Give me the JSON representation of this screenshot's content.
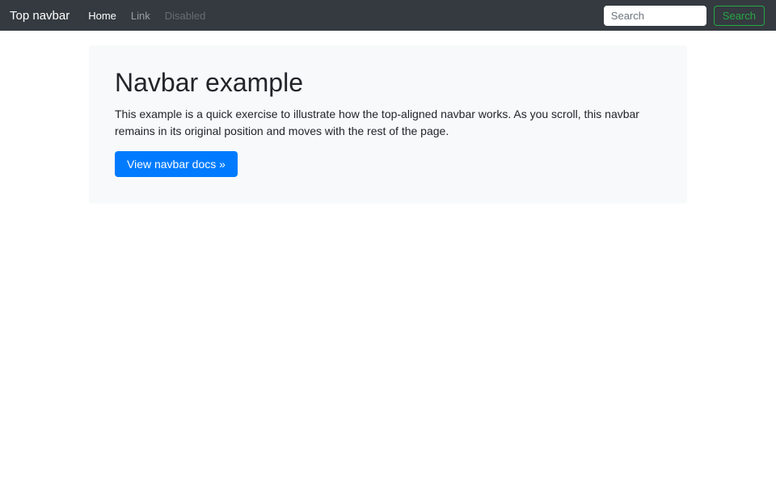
{
  "navbar": {
    "brand": "Top navbar",
    "links": [
      {
        "label": "Home",
        "state": "active"
      },
      {
        "label": "Link",
        "state": "normal"
      },
      {
        "label": "Disabled",
        "state": "disabled"
      }
    ],
    "search": {
      "placeholder": "Search",
      "button_label": "Search"
    }
  },
  "jumbotron": {
    "title": "Navbar example",
    "body": "This example is a quick exercise to illustrate how the top-aligned navbar works. As you scroll, this navbar remains in its original position and moves with the rest of the page.",
    "cta_label": "View navbar docs »"
  },
  "colors": {
    "navbar_bg": "#343a40",
    "primary": "#007bff",
    "success": "#28a745",
    "jumbotron_bg": "#f8f9fa"
  }
}
